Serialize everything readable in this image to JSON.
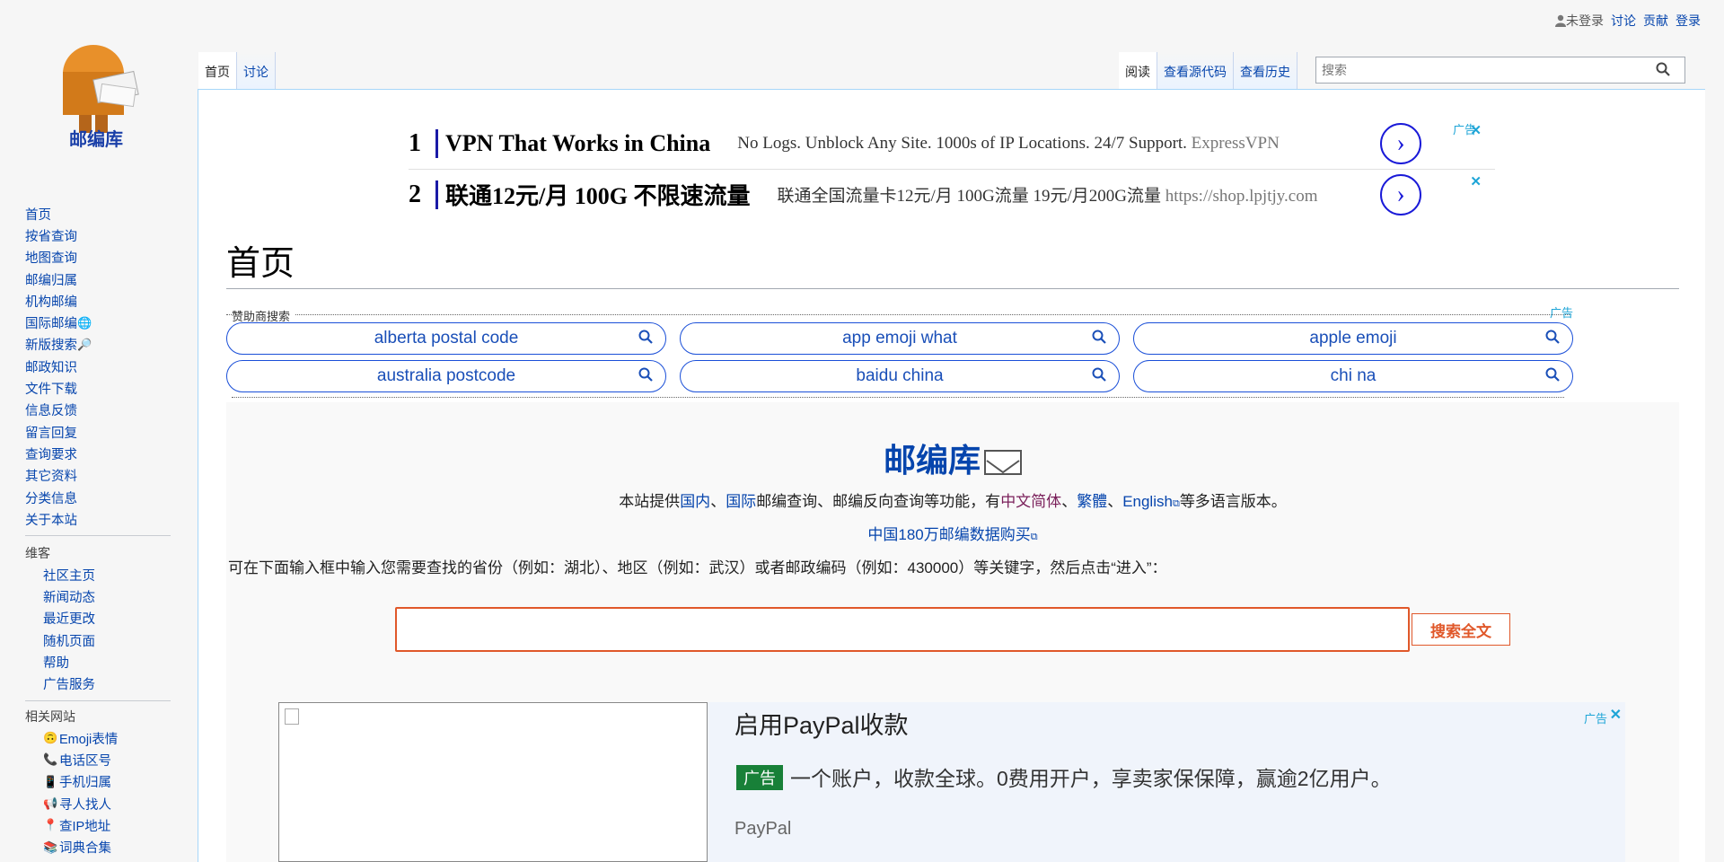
{
  "site": {
    "logo_text": "邮编库"
  },
  "personal": {
    "anon": "未登录",
    "talk": "讨论",
    "contrib": "贡献",
    "login": "登录"
  },
  "tabs": {
    "main": "首页",
    "talk": "讨论",
    "read": "阅读",
    "source": "查看源代码",
    "history": "查看历史"
  },
  "search": {
    "placeholder": "搜索"
  },
  "nav": [
    {
      "label": "首页"
    },
    {
      "label": "按省查询"
    },
    {
      "label": "地图查询"
    },
    {
      "label": "邮编归属"
    },
    {
      "label": "机构邮编"
    },
    {
      "label": "国际邮编",
      "icon": "globe-icon"
    },
    {
      "label": "新版搜索",
      "icon": "magnifier-icon"
    },
    {
      "label": "邮政知识"
    },
    {
      "label": "文件下载"
    },
    {
      "label": "信息反馈"
    },
    {
      "label": "留言回复"
    },
    {
      "label": "查询要求"
    },
    {
      "label": "其它资料"
    },
    {
      "label": "分类信息"
    },
    {
      "label": "关于本站"
    }
  ],
  "wiki": {
    "heading": "维客",
    "items": [
      "社区主页",
      "新闻动态",
      "最近更改",
      "随机页面",
      "帮助",
      "广告服务"
    ]
  },
  "related": {
    "heading": "相关网站",
    "items": [
      {
        "label": "Emoji表情",
        "icon": "emoji-icon"
      },
      {
        "label": "电话区号",
        "icon": "phone-icon"
      },
      {
        "label": "手机归属",
        "icon": "mobile-icon"
      },
      {
        "label": "寻人找人",
        "icon": "megaphone-icon"
      },
      {
        "label": "查IP地址",
        "icon": "pin-icon"
      },
      {
        "label": "词典合集",
        "icon": "books-icon"
      }
    ]
  },
  "ads": {
    "label": "广告",
    "close": "✕",
    "rows": [
      {
        "num": "1",
        "title": "VPN That Works in China",
        "desc": "No Logs. Unblock Any Site. 1000s of IP Locations. 24/7 Support.",
        "url": "ExpressVPN"
      },
      {
        "num": "2",
        "title": "联通12元/月 100G 不限速流量",
        "desc": "联通全国流量卡12元/月 100G流量 19元/月200G流量",
        "url": "https://shop.lpjtjy.com"
      }
    ]
  },
  "heading": "首页",
  "sponsor": {
    "caption": "赞助商搜索",
    "ad_label": "广告",
    "pills": [
      "alberta postal code",
      "app emoji what",
      "apple emoji",
      "australia postcode",
      "baidu china",
      "chi na"
    ]
  },
  "intro": {
    "title": "邮编库",
    "line1_a": "本站提供",
    "line1_domestic": "国内",
    "line1_sep1": "、",
    "line1_intl": "国际",
    "line1_b": "邮编查询、邮编反向查询等功能，有",
    "line1_sc": "中文简体",
    "line1_sep2": "、",
    "line1_tc": "繁體",
    "line1_sep3": "、",
    "line1_en": "English",
    "line1_c": "等多语言版本。",
    "buy_link": "中国180万邮编数据购买",
    "hint": "可在下面输入框中输入您需要查找的省份（例如：湖北）、地区（例如：武汉）或者邮政编码（例如：430000）等关键字，然后点击“进入”：",
    "button": "搜索全文"
  },
  "paypal": {
    "title": "启用PayPal收款",
    "badge": "广告",
    "desc": "一个账户，收款全球。0费用开户，享卖家保保障，赢逾2亿用户。",
    "brand": "PayPal",
    "ad_label": "广告",
    "close": "✕"
  }
}
